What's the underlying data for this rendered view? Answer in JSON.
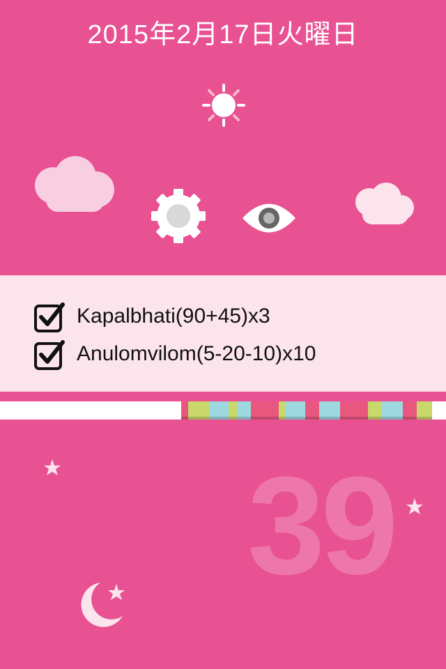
{
  "header": {
    "date": "2015年2月17日火曜日"
  },
  "scene": {
    "icons": [
      "sun-icon",
      "cloud-icon",
      "gear-icon",
      "eye-icon",
      "star-icon",
      "moon-icon"
    ],
    "colors": {
      "background": "#e85192",
      "panel": "#fce4ec",
      "cloud": "#f8cfe0",
      "sun": "#ffffff"
    }
  },
  "tasks": [
    {
      "label": "Kapalbhati(90+45)x3",
      "checked": true
    },
    {
      "label": "Anulomvilom(5-20-10)x10",
      "checked": true
    }
  ],
  "progress": {
    "segment_colors": [
      "#e8587e",
      "#c8d86a",
      "#9ed8e0",
      "#c8d86a",
      "#9ed8e0",
      "#e8587e",
      "#c8d86a",
      "#9ed8e0",
      "#e8587e",
      "#9ed8e0",
      "#e8587e",
      "#c8d86a",
      "#9ed8e0",
      "#e8587e",
      "#c8d86a"
    ]
  },
  "counter": {
    "value": "39"
  }
}
